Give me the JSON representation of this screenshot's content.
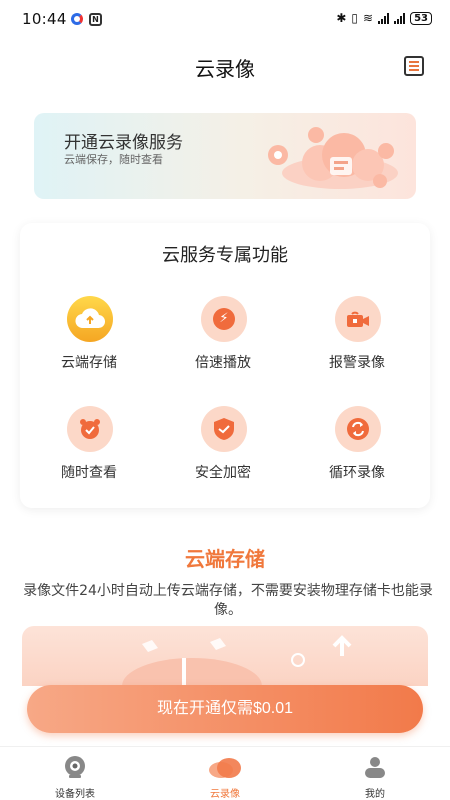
{
  "status_bar": {
    "time": "10:44",
    "battery": "53"
  },
  "header": {
    "title": "云录像",
    "menu_icon": "menu-list-icon"
  },
  "banner": {
    "title": "开通云录像服务",
    "subtitle": "云端保存，随时查看"
  },
  "features": {
    "title": "云服务专属功能",
    "items": [
      {
        "label": "云端存储",
        "icon": "cloud-upload-icon"
      },
      {
        "label": "倍速播放",
        "icon": "lightning-icon"
      },
      {
        "label": "报警录像",
        "icon": "alarm-camera-icon"
      },
      {
        "label": "随时查看",
        "icon": "alarm-clock-icon"
      },
      {
        "label": "安全加密",
        "icon": "shield-check-icon"
      },
      {
        "label": "循环录像",
        "icon": "loop-icon"
      }
    ]
  },
  "storage_section": {
    "title": "云端存储",
    "description": "录像文件24小时自动上传云端存储，不需要安装物理存储卡也能录像。"
  },
  "cta": {
    "label": "现在开通仅需$0.01"
  },
  "bottom_nav": {
    "items": [
      {
        "label": "设备列表",
        "icon": "camera-icon",
        "active": false
      },
      {
        "label": "云录像",
        "icon": "cloud-icon",
        "active": true
      },
      {
        "label": "我的",
        "icon": "user-icon",
        "active": false
      }
    ]
  },
  "colors": {
    "accent": "#f0783c",
    "accent_light": "#fcd8c8",
    "icon_yellow": "#f5a623"
  }
}
